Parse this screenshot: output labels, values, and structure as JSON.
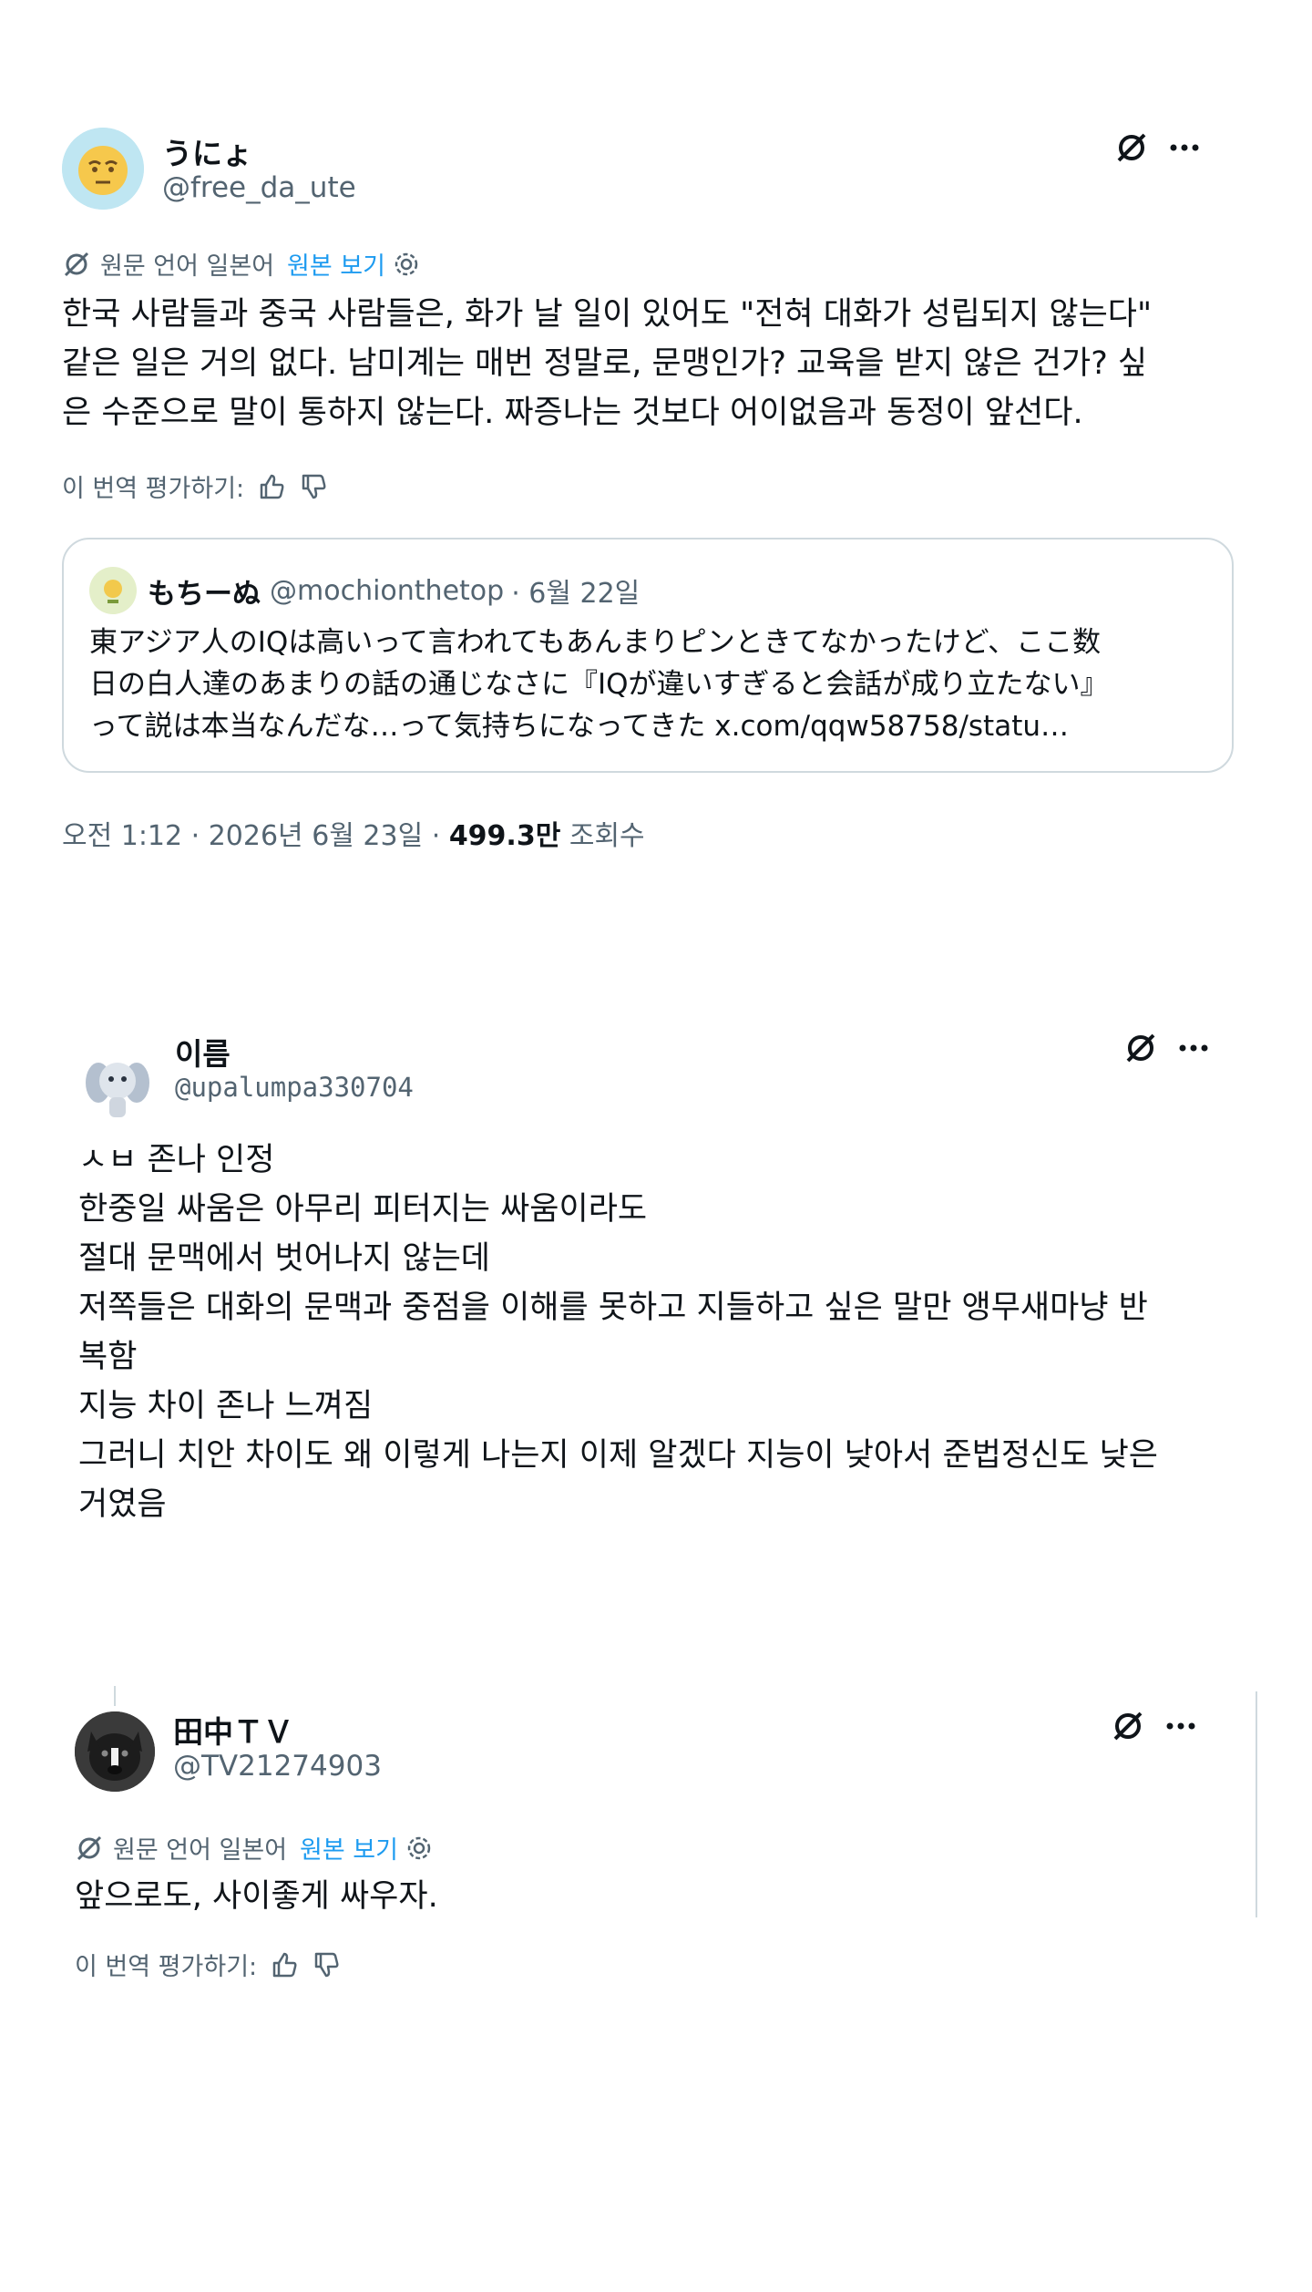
{
  "posts": [
    {
      "display_name": "うにょ",
      "handle": "@free_da_ute",
      "translation": {
        "label": "원문 언어 일본어",
        "show_original": "원본 보기"
      },
      "text": "한국 사람들과 중국 사람들은, 화가 날 일이 있어도 \"전혀 대화가 성립되지 않는다\"\n같은 일은 거의 없다. 남미계는 매번 정말로, 문맹인가? 교육을 받지 않은 건가? 싶\n은 수준으로 말이 통하지 않는다. 짜증나는 것보다 어이없음과 동정이 앞선다.",
      "rate_label": "이 번역 평가하기:",
      "quote": {
        "display_name": "もちーぬ",
        "handle": "@mochionthetop",
        "date": "· 6월 22일",
        "text": "東アジア人のIQは高いって言われてもあんまりピンときてなかったけど、ここ数\n日の白人達のあまりの話の通じなさに『IQが違いすぎると会話が成り立たない』\nって説は本当なんだな…って気持ちになってきた x.com/qqw58758/statu…"
      },
      "meta": {
        "time_date": "오전 1:12 · 2026년 6월 23일 ·",
        "views_count": "499.3만",
        "views_label": "조회수"
      }
    },
    {
      "display_name": "이름",
      "handle": "@upalumpa330704",
      "text": "ㅅㅂ 존나 인정\n한중일 싸움은 아무리 피터지는 싸움이라도\n절대 문맥에서 벗어나지 않는데\n저쪽들은 대화의 문맥과 중점을 이해를 못하고 지들하고 싶은 말만 앵무새마냥 반\n복함\n지능 차이 존나 느껴짐\n그러니 치안 차이도 왜 이렇게 나는지 이제 알겠다 지능이 낮아서 준법정신도 낮은\n거였음"
    },
    {
      "display_name": "田中ＴＶ",
      "handle": "@TV21274903",
      "translation": {
        "label": "원문 언어 일본어",
        "show_original": "원본 보기"
      },
      "text": "앞으로도, 사이좋게 싸우자.",
      "rate_label": "이 번역 평가하기:"
    }
  ],
  "icons": {
    "grok": "grok-icon",
    "more": "more-icon",
    "translate": "translate-icon",
    "settings": "gear-icon",
    "thumbs_up": "thumbs-up-icon",
    "thumbs_down": "thumbs-down-icon"
  },
  "colors": {
    "text": "#0f1419",
    "secondary": "#536471",
    "link": "#1d9bf0",
    "border": "#cfd9de"
  }
}
